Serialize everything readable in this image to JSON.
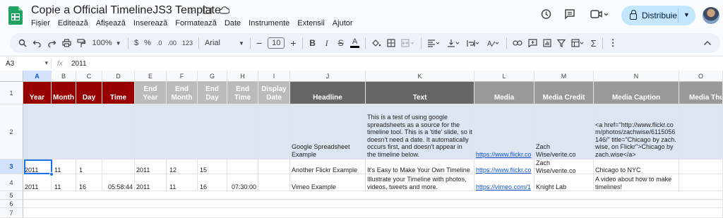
{
  "app": {
    "title": "Copie a Official TimelineJS3 Template",
    "menus": [
      "Fișier",
      "Editează",
      "Afișează",
      "Inserează",
      "Formatează",
      "Date",
      "Instrumente",
      "Extensii",
      "Ajutor"
    ],
    "share_label": "Distribuie"
  },
  "toolbar": {
    "zoom": "100%",
    "currency": "$",
    "percent": "%",
    "dec_decrease": ".0",
    "dec_increase": ".00",
    "number_format": "123",
    "font": "Arial",
    "font_size": "10",
    "bold": "B",
    "italic": "I",
    "text_color_letter": "A"
  },
  "formula_bar": {
    "cell_ref": "A3",
    "fx": "fx",
    "value": "2011"
  },
  "columns": [
    "A",
    "B",
    "C",
    "D",
    "E",
    "F",
    "G",
    "H",
    "I",
    "J",
    "K",
    "L",
    "M",
    "N",
    "O"
  ],
  "rows": [
    "1",
    "2",
    "3",
    "4",
    "5",
    "6",
    "7"
  ],
  "headers": {
    "A": "Year",
    "B": "Month",
    "C": "Day",
    "D": "Time",
    "E": "End Year",
    "F": "End Month",
    "G": "End Day",
    "H": "End Time",
    "I": "Display Date",
    "J": "Headline",
    "K": "Text",
    "L": "Media",
    "M": "Media Credit",
    "N": "Media Caption",
    "O": "Media Thumbna"
  },
  "row2": {
    "J": "Google Spreadsheet Example",
    "K": "This is a test of using google spreadsheets as a source for the timeline tool. This is a 'title' slide, so it doesn't need a date. It automatically occurs first, and doesn't appear in the timeline below.",
    "L": "https://www.flickr.co",
    "M": "Zach Wise/verite.co",
    "N": "<a href=\"http://www.flickr.com/photos/zachwise/6115056146/\" title=\"Chicago by zach.wise, on Flickr\">Chicago by zach.wise</a>"
  },
  "row3": {
    "A": "2011",
    "B": "11",
    "C": "1",
    "E": "2011",
    "F": "12",
    "G": "15",
    "J": "Another Flickr Example",
    "K": "It's Easy to Make Your Own Timeline",
    "L": "https://www.flickr.co",
    "M": "Zach Wise/verite.co",
    "N": "Chicago to NYC"
  },
  "row4": {
    "A": "2011",
    "B": "11",
    "C": "16",
    "D": "05:58:44",
    "E": "2011",
    "F": "11",
    "G": "16",
    "H": "07:30:00",
    "J": "Vimeo Example",
    "K": "Illustrate your Timeline with photos, videos, tweets and more.",
    "L": "https://vimeo.com/1",
    "M": "Knight Lab",
    "N": "A video about how to make timelines!"
  },
  "colors": {
    "date_header": "#980000",
    "end_header": "#bbbbbb",
    "headline_header": "#666666",
    "media_header": "#999999",
    "title_row": "#dce6f2",
    "share_button": "#c2e7ff",
    "selection": "#1a73e8"
  }
}
